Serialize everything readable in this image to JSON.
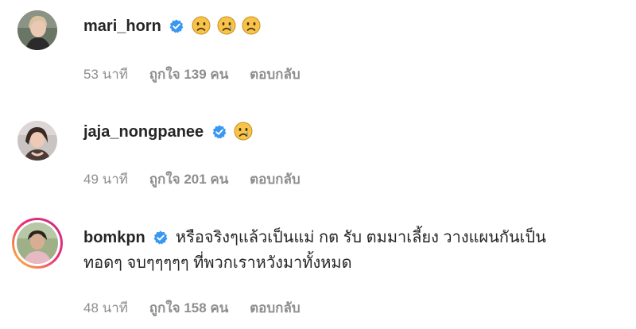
{
  "comments": [
    {
      "username": "mari_horn",
      "text": "",
      "emojis": [
        "sad-face-emoji",
        "crying-face-emoji",
        "sad-face-emoji"
      ],
      "time": "53 นาที",
      "likes": "ถูกใจ 139 คน",
      "reply": "ตอบกลับ"
    },
    {
      "username": "jaja_nongpanee",
      "text": "",
      "emojis": [
        "crying-face-emoji"
      ],
      "time": "49 นาที",
      "likes": "ถูกใจ 201 คน",
      "reply": "ตอบกลับ"
    },
    {
      "username": "bomkpn",
      "text_line1": "หรือจริงๆแล้วเป็นแม่ กต รับ ตมมาเลี้ยง วางแผนกันเป็น",
      "text_line2": "ทอดๆ จบๆๆๆๆๆ ที่พวกเราหวังมาทั้งหมด",
      "time": "48 นาที",
      "likes": "ถูกใจ 158 คน",
      "reply": "ตอบกลับ"
    }
  ],
  "colors": {
    "verified_badge": "#3897f0",
    "secondary_text": "#8e8e8e",
    "primary_text": "#262626",
    "emoji_face": "#f7c34a"
  }
}
